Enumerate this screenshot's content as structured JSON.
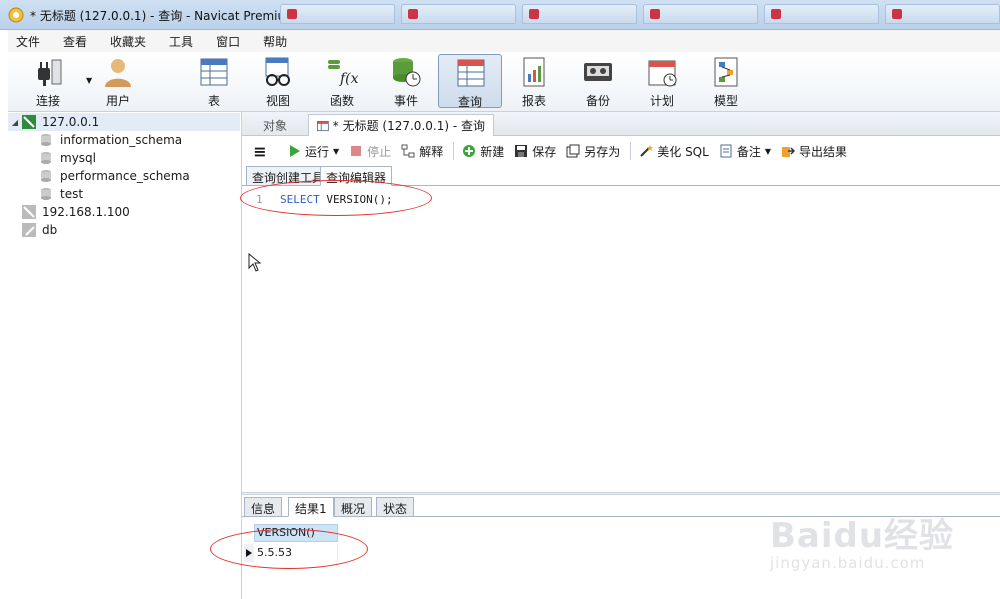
{
  "window": {
    "title": "* 无标题 (127.0.0.1) - 查询 - Navicat Premium"
  },
  "menu": [
    "文件",
    "查看",
    "收藏夹",
    "工具",
    "窗口",
    "帮助"
  ],
  "toolbar": {
    "connect": "连接",
    "user": "用户",
    "table": "表",
    "view": "视图",
    "function": "函数",
    "event": "事件",
    "query": "查询",
    "report": "报表",
    "backup": "备份",
    "schedule": "计划",
    "model": "模型"
  },
  "tree": {
    "server1": "127.0.0.1",
    "databases": [
      "information_schema",
      "mysql",
      "performance_schema",
      "test"
    ],
    "server2": "192.168.1.100",
    "server3": "db"
  },
  "doc_tabs": {
    "objects": "对象",
    "query": "* 无标题 (127.0.0.1) - 查询"
  },
  "query_toolbar": {
    "run": "运行",
    "stop": "停止",
    "explain": "解释",
    "new": "新建",
    "save": "保存",
    "save_as": "另存为",
    "beautify": "美化 SQL",
    "comment": "备注",
    "export": "导出结果"
  },
  "sub_tabs": {
    "builder": "查询创建工具",
    "editor": "查询编辑器"
  },
  "editor": {
    "line_number": "1",
    "keyword": "SELECT",
    "rest": " VERSION();"
  },
  "result_tabs": [
    "信息",
    "结果1",
    "概况",
    "状态"
  ],
  "results": {
    "column": "VERSION()",
    "value": "5.5.53"
  },
  "watermark": {
    "main": "Baidu经验",
    "sub": "jingyan.baidu.com"
  }
}
